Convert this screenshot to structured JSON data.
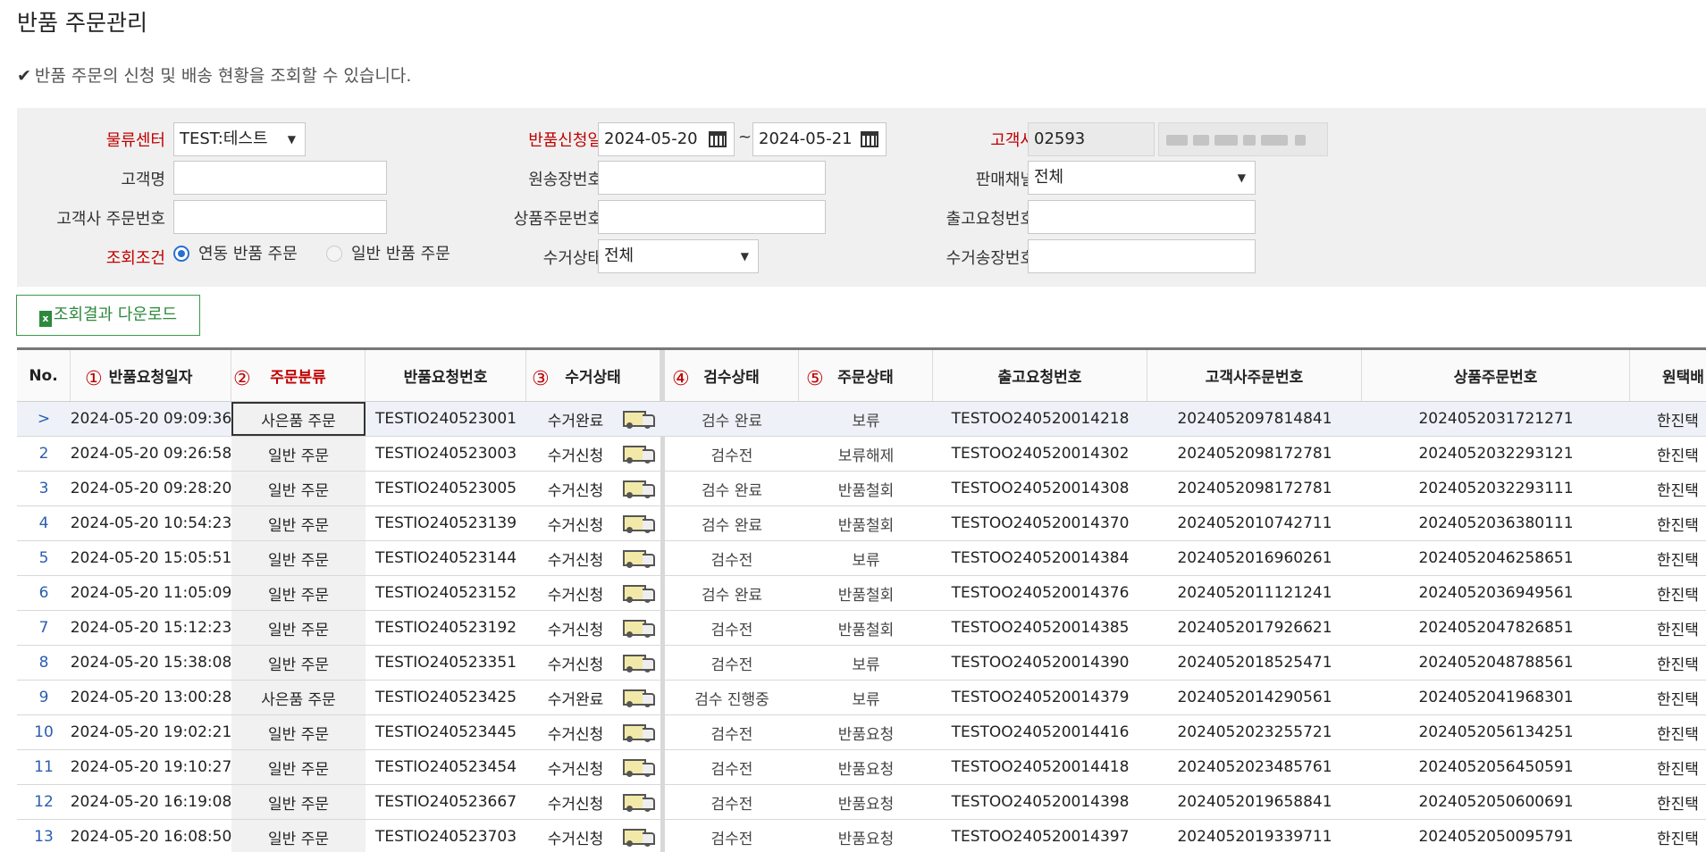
{
  "page": {
    "title": "반품 주문관리",
    "description": "반품 주문의 신청 및 배송 현황을 조회할 수 있습니다.",
    "check_icon": "check-icon"
  },
  "search": {
    "center_label": "물류센터",
    "center_value": "TEST:테스트",
    "return_date_label": "반품신청일",
    "date_from": "2024-05-20",
    "date_to": "2024-05-21",
    "date_sep": "~",
    "customer_label": "고객사",
    "customer_code": "02593",
    "customer_name_label": "고객명",
    "orig_invoice_label": "원송장번호",
    "sales_channel_label": "판매채널",
    "sales_channel_value": "전체",
    "customer_order_label": "고객사 주문번호",
    "product_order_label": "상품주문번호",
    "release_req_label": "출고요청번호",
    "condition_label": "조회조건",
    "radio_linked": "연동 반품 주문",
    "radio_normal": "일반 반품 주문",
    "pickup_status_label": "수거상태",
    "pickup_status_value": "전체",
    "pickup_invoice_label": "수거송장번호"
  },
  "download_button": "조회결과 다운로드",
  "grid": {
    "headers": {
      "no": "No.",
      "date": "반품요청일자",
      "type": "주문분류",
      "req_no": "반품요청번호",
      "pickup": "수거상태",
      "inspect": "검수상태",
      "order_status": "주문상태",
      "release_no": "출고요청번호",
      "cust_order_no": "고객사주문번호",
      "prod_order_no": "상품주문번호",
      "carrier": "원택배"
    },
    "annotations": [
      "①",
      "②",
      "③",
      "④",
      "⑤"
    ],
    "rows": [
      {
        "no": ">",
        "date": "2024-05-20 09:09:36",
        "type": "사은품 주문",
        "req_no": "TESTIO240523001",
        "pickup": "수거완료",
        "inspect": "검수 완료",
        "order_status": "보류",
        "release_no": "TESTOO240520014218",
        "cust_order_no": "2024052097814841",
        "prod_order_no": "2024052031721271",
        "carrier": "한진택"
      },
      {
        "no": "2",
        "date": "2024-05-20 09:26:58",
        "type": "일반 주문",
        "req_no": "TESTIO240523003",
        "pickup": "수거신청",
        "inspect": "검수전",
        "order_status": "보류해제",
        "release_no": "TESTOO240520014302",
        "cust_order_no": "2024052098172781",
        "prod_order_no": "2024052032293121",
        "carrier": "한진택"
      },
      {
        "no": "3",
        "date": "2024-05-20 09:28:20",
        "type": "일반 주문",
        "req_no": "TESTIO240523005",
        "pickup": "수거신청",
        "inspect": "검수 완료",
        "order_status": "반품철회",
        "release_no": "TESTOO240520014308",
        "cust_order_no": "2024052098172781",
        "prod_order_no": "2024052032293111",
        "carrier": "한진택"
      },
      {
        "no": "4",
        "date": "2024-05-20 10:54:23",
        "type": "일반 주문",
        "req_no": "TESTIO240523139",
        "pickup": "수거신청",
        "inspect": "검수 완료",
        "order_status": "반품철회",
        "release_no": "TESTOO240520014370",
        "cust_order_no": "2024052010742711",
        "prod_order_no": "2024052036380111",
        "carrier": "한진택"
      },
      {
        "no": "5",
        "date": "2024-05-20 15:05:51",
        "type": "일반 주문",
        "req_no": "TESTIO240523144",
        "pickup": "수거신청",
        "inspect": "검수전",
        "order_status": "보류",
        "release_no": "TESTOO240520014384",
        "cust_order_no": "2024052016960261",
        "prod_order_no": "2024052046258651",
        "carrier": "한진택"
      },
      {
        "no": "6",
        "date": "2024-05-20 11:05:09",
        "type": "일반 주문",
        "req_no": "TESTIO240523152",
        "pickup": "수거신청",
        "inspect": "검수 완료",
        "order_status": "반품철회",
        "release_no": "TESTOO240520014376",
        "cust_order_no": "2024052011121241",
        "prod_order_no": "2024052036949561",
        "carrier": "한진택"
      },
      {
        "no": "7",
        "date": "2024-05-20 15:12:23",
        "type": "일반 주문",
        "req_no": "TESTIO240523192",
        "pickup": "수거신청",
        "inspect": "검수전",
        "order_status": "반품철회",
        "release_no": "TESTOO240520014385",
        "cust_order_no": "2024052017926621",
        "prod_order_no": "2024052047826851",
        "carrier": "한진택"
      },
      {
        "no": "8",
        "date": "2024-05-20 15:38:08",
        "type": "일반 주문",
        "req_no": "TESTIO240523351",
        "pickup": "수거신청",
        "inspect": "검수전",
        "order_status": "보류",
        "release_no": "TESTOO240520014390",
        "cust_order_no": "2024052018525471",
        "prod_order_no": "2024052048788561",
        "carrier": "한진택"
      },
      {
        "no": "9",
        "date": "2024-05-20 13:00:28",
        "type": "사은품 주문",
        "req_no": "TESTIO240523425",
        "pickup": "수거완료",
        "inspect": "검수 진행중",
        "order_status": "보류",
        "release_no": "TESTOO240520014379",
        "cust_order_no": "2024052014290561",
        "prod_order_no": "2024052041968301",
        "carrier": "한진택"
      },
      {
        "no": "10",
        "date": "2024-05-20 19:02:21",
        "type": "일반 주문",
        "req_no": "TESTIO240523445",
        "pickup": "수거신청",
        "inspect": "검수전",
        "order_status": "반품요청",
        "release_no": "TESTOO240520014416",
        "cust_order_no": "2024052023255721",
        "prod_order_no": "2024052056134251",
        "carrier": "한진택"
      },
      {
        "no": "11",
        "date": "2024-05-20 19:10:27",
        "type": "일반 주문",
        "req_no": "TESTIO240523454",
        "pickup": "수거신청",
        "inspect": "검수전",
        "order_status": "반품요청",
        "release_no": "TESTOO240520014418",
        "cust_order_no": "2024052023485761",
        "prod_order_no": "2024052056450591",
        "carrier": "한진택"
      },
      {
        "no": "12",
        "date": "2024-05-20 16:19:08",
        "type": "일반 주문",
        "req_no": "TESTIO240523667",
        "pickup": "수거신청",
        "inspect": "검수전",
        "order_status": "반품요청",
        "release_no": "TESTOO240520014398",
        "cust_order_no": "2024052019658841",
        "prod_order_no": "2024052050600691",
        "carrier": "한진택"
      },
      {
        "no": "13",
        "date": "2024-05-20 16:08:50",
        "type": "일반 주문",
        "req_no": "TESTIO240523703",
        "pickup": "수거신청",
        "inspect": "검수전",
        "order_status": "반품요청",
        "release_no": "TESTOO240520014397",
        "cust_order_no": "2024052019339711",
        "prod_order_no": "2024052050095791",
        "carrier": "한진택"
      }
    ]
  }
}
